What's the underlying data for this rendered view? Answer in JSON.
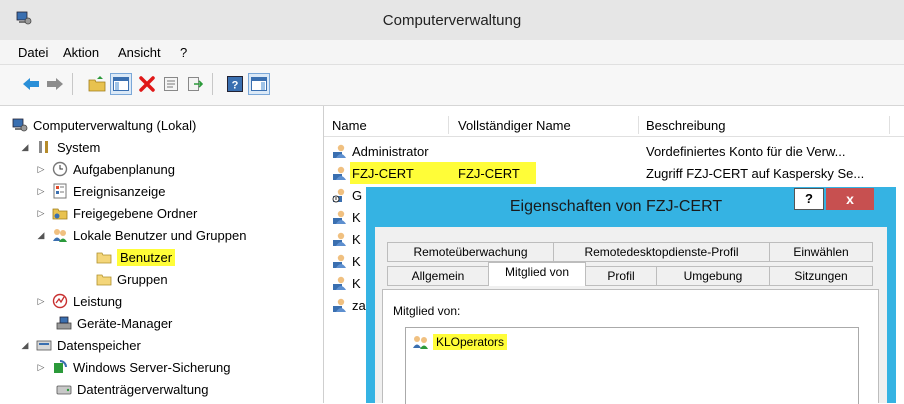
{
  "window": {
    "title": "Computerverwaltung"
  },
  "menu": [
    "Datei",
    "Aktion",
    "Ansicht",
    "?"
  ],
  "toolbar": {
    "icons": [
      "back-arrow-icon",
      "forward-arrow-icon",
      "up-folder-icon",
      "show-hide-tree-icon",
      "delete-icon",
      "properties-icon",
      "export-list-icon",
      "help-icon",
      "show-hide-action-pane-icon"
    ]
  },
  "tree": {
    "root": "Computerverwaltung (Lokal)",
    "system": "System",
    "aufgabenplanung": "Aufgabenplanung",
    "ereignisanzeige": "Ereignisanzeige",
    "freigegebene_ordner": "Freigegebene Ordner",
    "lokale_benutzer": "Lokale Benutzer und Gruppen",
    "benutzer": "Benutzer",
    "gruppen": "Gruppen",
    "leistung": "Leistung",
    "geraete_manager": "Geräte-Manager",
    "datenspeicher": "Datenspeicher",
    "server_sicherung": "Windows Server-Sicherung",
    "datentraeger": "Datenträgerverwaltung"
  },
  "list": {
    "headers": [
      "Name",
      "Vollständiger Name",
      "Beschreibung"
    ],
    "rows": [
      {
        "name": "Administrator",
        "fullname": "",
        "description": "Vordefiniertes Konto für die Verw..."
      },
      {
        "name": "FZJ-CERT",
        "fullname": "FZJ-CERT",
        "description": "Zugriff FZJ-CERT auf Kaspersky Se..."
      },
      {
        "name": "G",
        "fullname": "",
        "description": ""
      },
      {
        "name": "K",
        "fullname": "",
        "description": ""
      },
      {
        "name": "K",
        "fullname": "",
        "description": ""
      },
      {
        "name": "K",
        "fullname": "",
        "description": ""
      },
      {
        "name": "K",
        "fullname": "",
        "description": ""
      },
      {
        "name": "za",
        "fullname": "",
        "description": ""
      }
    ]
  },
  "dialog": {
    "title": "Eigenschaften von FZJ-CERT",
    "help_label": "?",
    "close_label": "x",
    "tabs_row1": [
      "Remoteüberwachung",
      "Remotedesktopdienste-Profil",
      "Einwählen"
    ],
    "tabs_row2": [
      "Allgemein",
      "Mitglied von",
      "Profil",
      "Umgebung",
      "Sitzungen"
    ],
    "member_label": "Mitglied von:",
    "members": [
      "KLOperators"
    ]
  },
  "colors": {
    "highlight": "#fffd38",
    "dialog_frame": "#35b3e3",
    "close_button": "#c75050"
  }
}
